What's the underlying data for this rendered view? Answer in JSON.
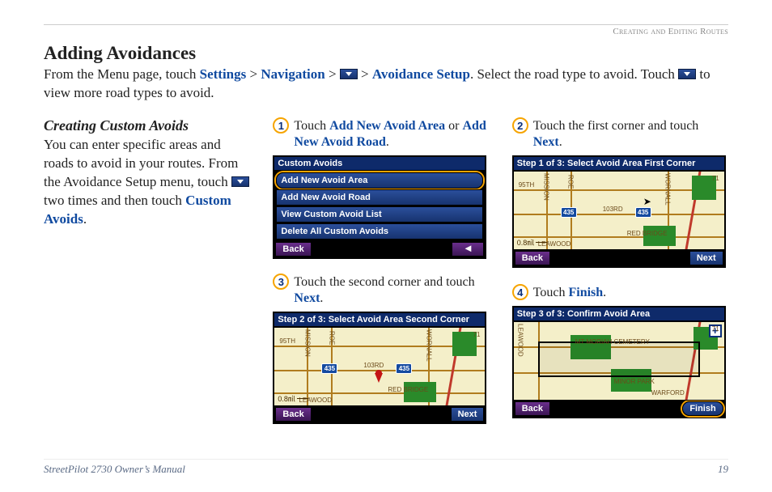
{
  "header_section": "Creating and Editing Routes",
  "title": "Adding Avoidances",
  "intro": {
    "a": "From the Menu page, touch ",
    "settings": "Settings",
    "gt1": " > ",
    "navigation": "Navigation",
    "gt2": " > ",
    "gt3": " > ",
    "avoidance": "Avoidance Setup",
    "b": ". Select the road type to avoid. Touch ",
    "c": " to view more road types to avoid."
  },
  "left": {
    "subhead": "Creating Custom Avoids",
    "p1a": "You can enter specific areas and roads to avoid in your routes. From the Avoidance Setup menu, touch ",
    "p1b": " two times and then touch ",
    "custom": "Custom Avoids",
    "p1c": "."
  },
  "steps": {
    "s1": {
      "n": "1",
      "a": "Touch ",
      "b": "Add New Avoid Area",
      "c": " or ",
      "d": "Add New Avoid Road",
      "e": "."
    },
    "s2": {
      "n": "2",
      "a": "Touch the first corner and touch ",
      "b": "Next",
      "c": "."
    },
    "s3": {
      "n": "3",
      "a": "Touch the second corner and touch ",
      "b": "Next",
      "c": "."
    },
    "s4": {
      "n": "4",
      "a": "Touch ",
      "b": "Finish",
      "c": "."
    }
  },
  "shot1": {
    "title": "Custom Avoids",
    "items": [
      "Add New Avoid Area",
      "Add New Avoid Road",
      "View Custom Avoid List",
      "Delete All Custom Avoids"
    ],
    "back": "Back",
    "arrow": "◄"
  },
  "shot2": {
    "title": "Step 1 of 3: Select Avoid Area First Corner",
    "back": "Back",
    "next": "Next",
    "scale": "0.8㏕",
    "shields": [
      "435",
      "435"
    ],
    "labels": [
      "95TH",
      "103RD",
      "RED BRIDGE",
      "LEAWOOD",
      "MISSION",
      "ROE",
      "WORNALL",
      "71"
    ]
  },
  "shot3": {
    "title": "Step 2 of 3: Select Avoid Area Second Corner",
    "back": "Back",
    "next": "Next",
    "scale": "0.8㏕",
    "shields": [
      "435",
      "435"
    ],
    "labels": [
      "95TH",
      "103RD",
      "RED BRIDGE",
      "LEAWOOD",
      "MISSION",
      "ROE",
      "WORNALL",
      "71"
    ]
  },
  "shot4": {
    "title": "Step 3 of 3: Confirm Avoid Area",
    "back": "Back",
    "finish": "Finish",
    "labels": [
      "LEAWOOD",
      "MT MORIAH CEMETERY",
      "MINOR PARK",
      "WARFORD",
      "71"
    ],
    "plus": "+"
  },
  "footer": {
    "left": "StreetPilot 2730 Owner’s Manual",
    "right": "19"
  }
}
